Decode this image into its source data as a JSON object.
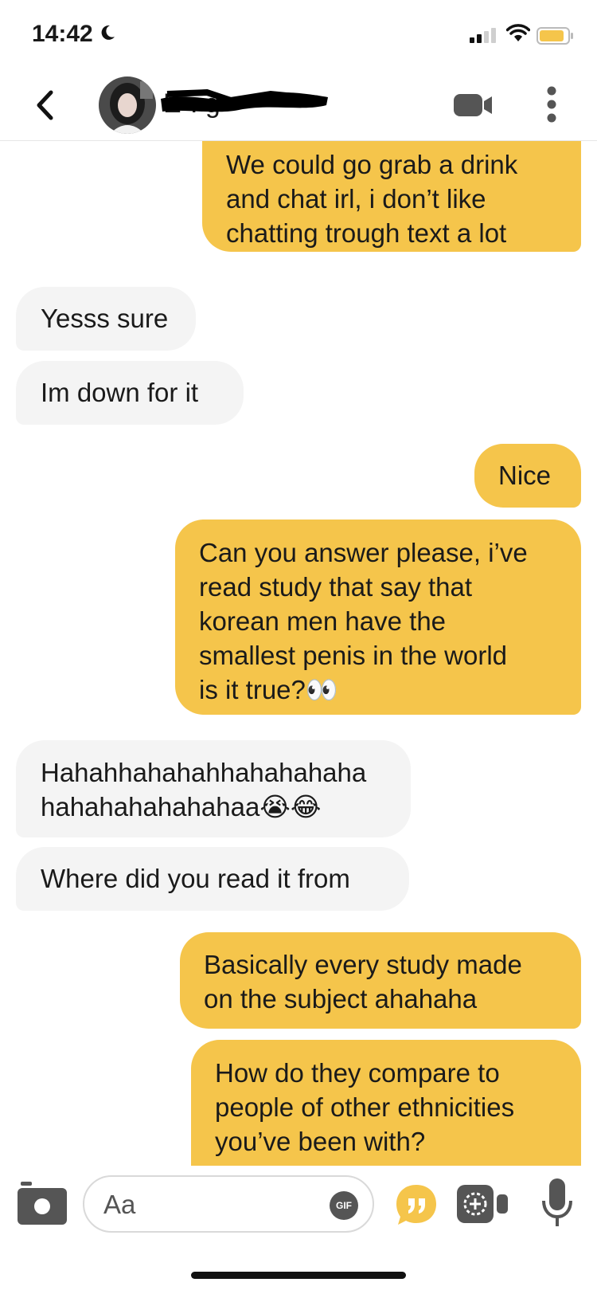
{
  "status_bar": {
    "time": "14:42"
  },
  "header": {
    "contact_name": "E·. g"
  },
  "messages": [
    {
      "id": "m1",
      "direction": "outgoing",
      "lines": [
        "We could go grab a drink",
        "and chat irl, i don’t like",
        "chatting trough text a lot"
      ]
    },
    {
      "id": "m2",
      "direction": "incoming",
      "lines": [
        "Yesss sure"
      ]
    },
    {
      "id": "m3",
      "direction": "incoming",
      "lines": [
        "Im down for it"
      ]
    },
    {
      "id": "m4",
      "direction": "outgoing",
      "lines": [
        "Nice"
      ]
    },
    {
      "id": "m5",
      "direction": "outgoing",
      "lines": [
        "Can you answer please, i’ve",
        "read study that say that",
        "korean men have the",
        "smallest penis in the world",
        "is it true?👀"
      ]
    },
    {
      "id": "m6",
      "direction": "incoming",
      "lines": [
        "Hahahhahahahhahahahaha",
        "hahahahahahahaa😭😂"
      ]
    },
    {
      "id": "m7",
      "direction": "incoming",
      "lines": [
        "Where did you read it from"
      ]
    },
    {
      "id": "m8",
      "direction": "outgoing",
      "lines": [
        "Basically every study made",
        "on the subject ahahaha"
      ]
    },
    {
      "id": "m9",
      "direction": "outgoing",
      "lines": [
        "How do they compare to",
        "people of other ethnicities",
        "you’ve been with?"
      ]
    }
  ],
  "composer": {
    "placeholder": "Aa",
    "gif_label": "GIF"
  },
  "colors": {
    "outgoing_bubble": "#f5c54b",
    "incoming_bubble": "#f4f4f4",
    "accent": "#f5c54b"
  }
}
